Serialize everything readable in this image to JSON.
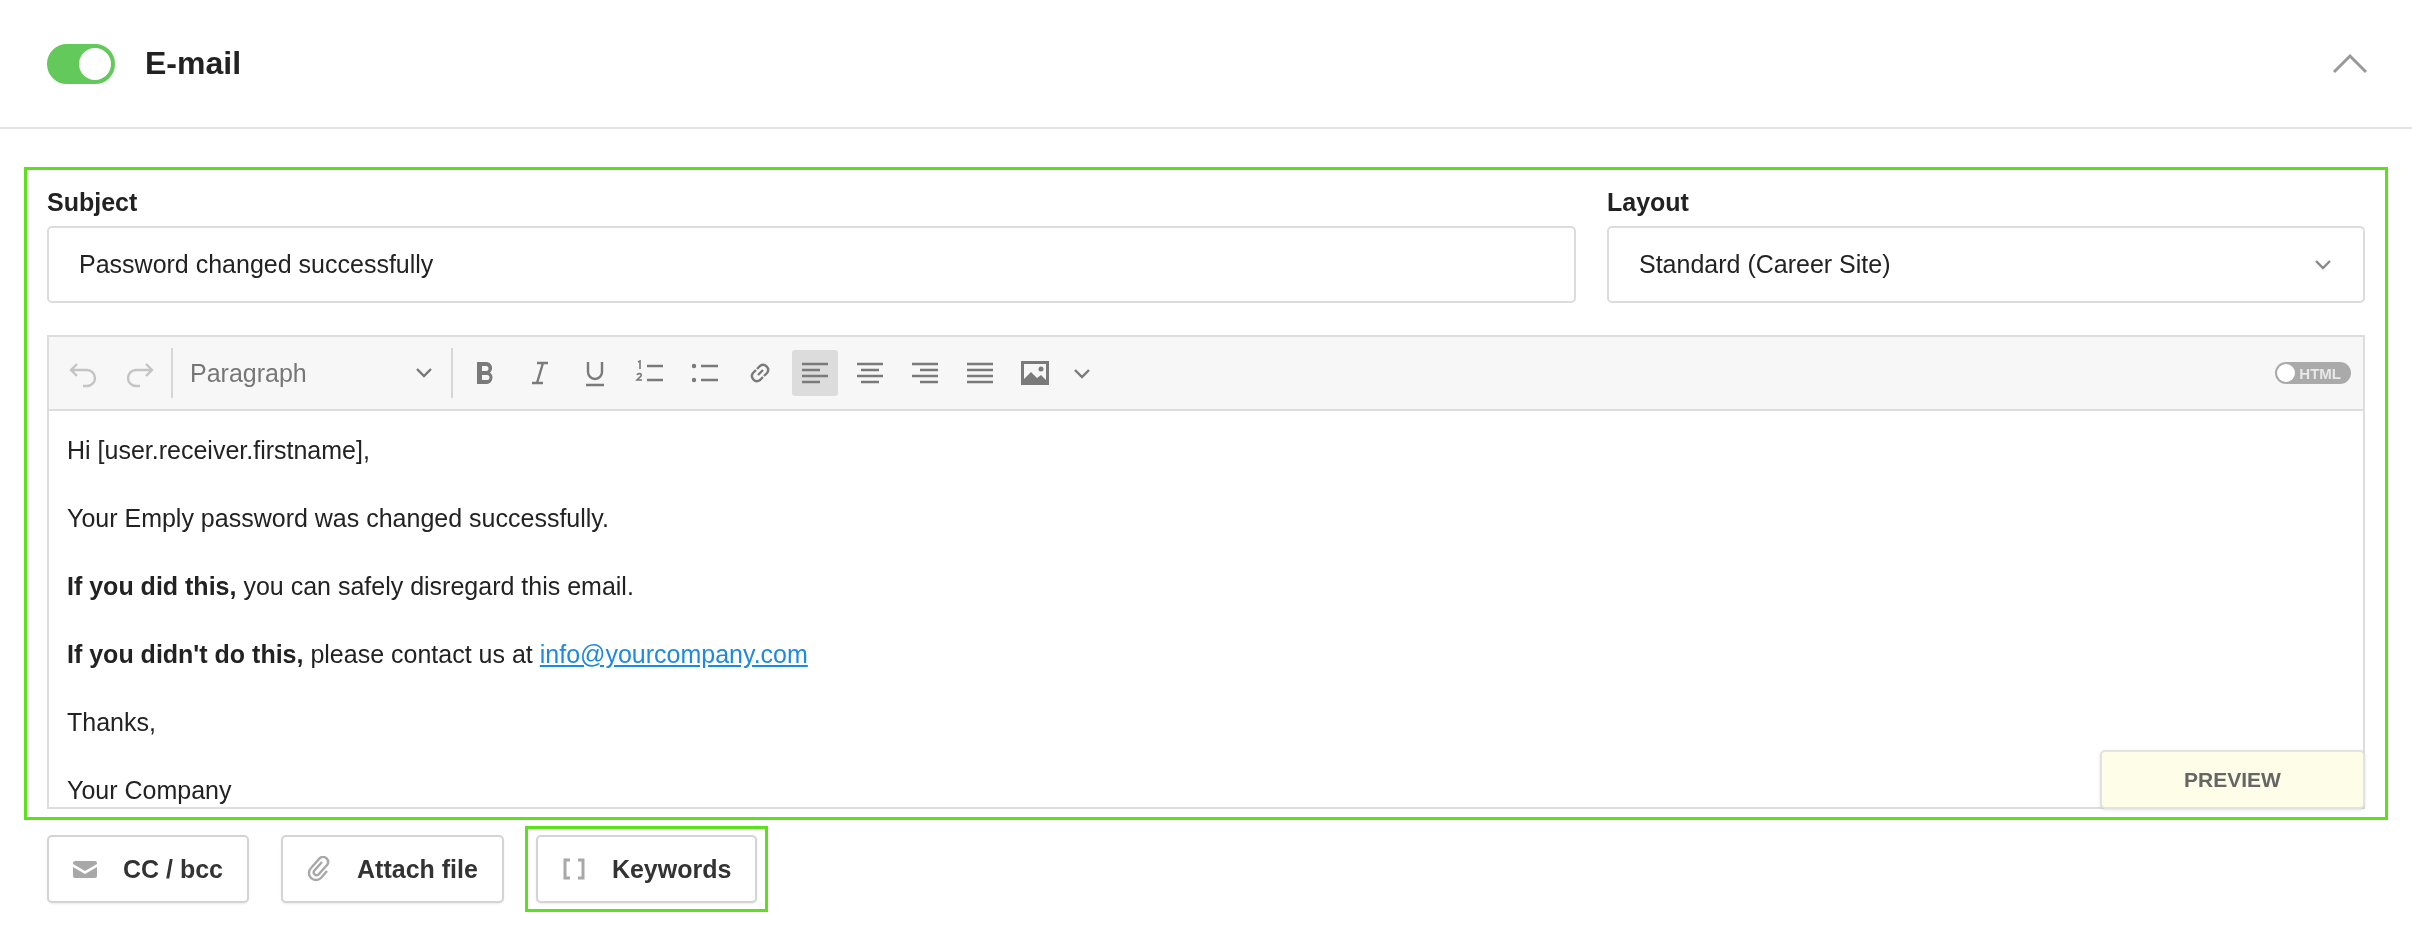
{
  "header": {
    "enabled": true,
    "title": "E-mail",
    "expanded": true
  },
  "form": {
    "highlighted": true,
    "subject": {
      "label": "Subject",
      "value": "Password changed successfully"
    },
    "layout": {
      "label": "Layout",
      "value": "Standard (Career Site)"
    }
  },
  "editor": {
    "history": [
      {
        "kind": "undo",
        "disabled": true
      },
      {
        "kind": "redo",
        "disabled": true
      }
    ],
    "block_format": "Paragraph",
    "tools": [
      {
        "kind": "bold",
        "selected": false
      },
      {
        "kind": "italic",
        "selected": false
      },
      {
        "kind": "underline",
        "selected": false
      },
      {
        "kind": "numbered-list",
        "selected": false
      },
      {
        "kind": "bullet-list",
        "selected": false
      },
      {
        "kind": "link",
        "selected": false
      },
      {
        "kind": "align-left",
        "selected": true
      },
      {
        "kind": "align-center",
        "selected": false
      },
      {
        "kind": "align-right",
        "selected": false
      },
      {
        "kind": "justify",
        "selected": false
      },
      {
        "kind": "image",
        "selected": false
      },
      {
        "kind": "more",
        "selected": false
      }
    ],
    "html_toggle": {
      "label": "HTML",
      "on": false
    },
    "paragraphs": [
      {
        "text": "Hi [user.receiver.firstname],"
      },
      {
        "text": "Your Emply password was changed successfully."
      },
      {
        "text": "**If you did this,** you can safely disregard this email."
      },
      {
        "text": "**If you didn't do this,** please contact us at ",
        "link": "info@yourcompany.com"
      },
      {
        "text": "Thanks,"
      },
      {
        "text": "Your Company"
      }
    ],
    "preview": "PREVIEW"
  },
  "actions": [
    {
      "kind": "mail",
      "label": "CC / bcc",
      "highlighted": false
    },
    {
      "kind": "attach",
      "label": "Attach file",
      "highlighted": false
    },
    {
      "kind": "brackets",
      "label": "Keywords",
      "highlighted": true
    }
  ]
}
